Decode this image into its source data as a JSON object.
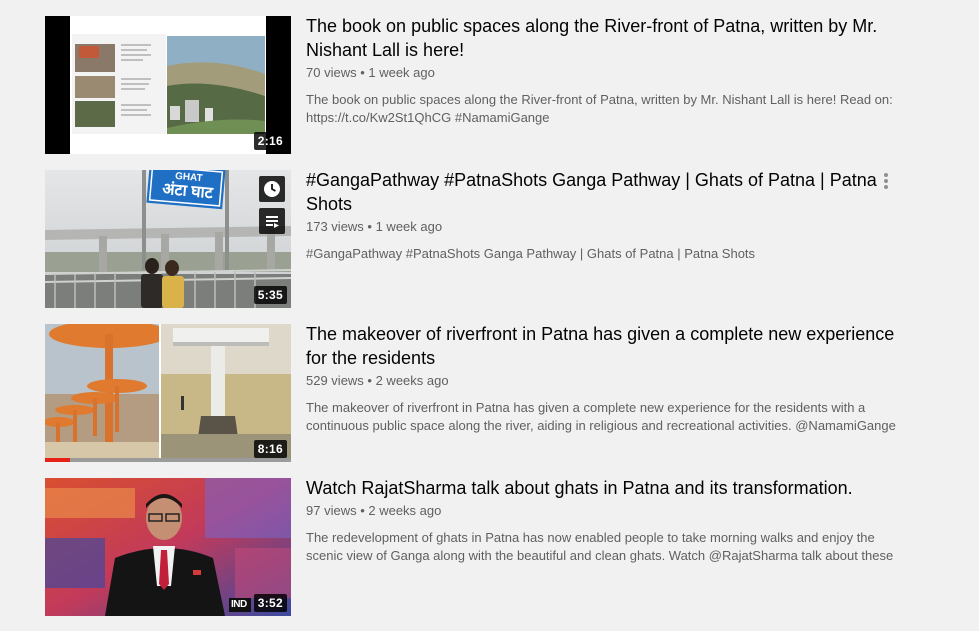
{
  "videos": [
    {
      "title": "The book on public spaces along the River-front of Patna, written by Mr. Nishant Lall is here!",
      "stats": "70 views • 1 week ago",
      "description": "The book on public spaces along the River-front of Patna, written by Mr. Nishant Lall is here! Read on: https://t.co/Kw2St1QhCG #NamamiGange",
      "duration": "2:16"
    },
    {
      "title": "#GangaPathway #PatnaShots Ganga Pathway | Ghats of Patna | Patna Shots",
      "stats": "173 views • 1 week ago",
      "description": "#GangaPathway #PatnaShots Ganga Pathway | Ghats of Patna | Patna Shots",
      "duration": "5:35",
      "sign_text_top": "GHAT",
      "sign_text": "अंटा घाट"
    },
    {
      "title": "The makeover of riverfront in Patna has given a complete new experience for the residents",
      "stats": "529 views • 2 weeks ago",
      "description": "The makeover of riverfront in Patna has given a complete new experience for the residents with a continuous public space along the river, aiding in religious and recreational activities. @NamamiGange",
      "duration": "8:16",
      "watch_progress": 0.1
    },
    {
      "title": "Watch RajatSharma talk about ghats in Patna and its transformation.",
      "stats": "97 views • 2 weeks ago",
      "description": "The redevelopment of ghats in Patna has now enabled people to take morning walks and enjoy the scenic view of Ganga along with the beautiful and clean ghats. Watch @RajatSharma talk about these",
      "duration": "3:52",
      "channel_logo": "IND"
    }
  ],
  "icons": {
    "watch_later": "clock-icon",
    "add_to_queue": "playlist-add-icon",
    "more": "more-vert-icon"
  },
  "colors": {
    "background": "#f1f1f1",
    "title": "#030303",
    "meta": "#606060",
    "progress": "#e62117"
  }
}
